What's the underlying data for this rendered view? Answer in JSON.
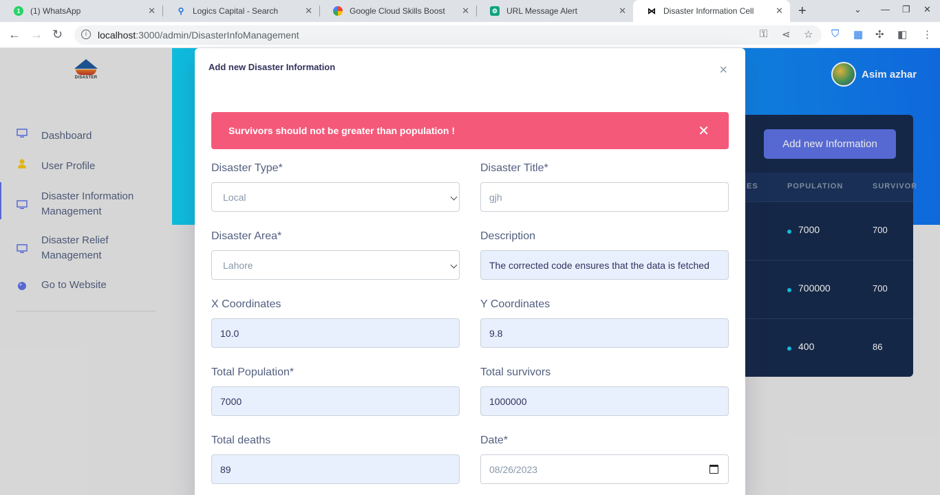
{
  "browser": {
    "tabs": [
      {
        "title": "(1) WhatsApp",
        "icon": "whatsapp-icon",
        "color": "#25d366"
      },
      {
        "title": "Logics Capital - Search",
        "icon": "search-icon",
        "color": "#1a73e8"
      },
      {
        "title": "Google Cloud Skills Boost",
        "icon": "google-cloud-icon",
        "color": "#ea4335"
      },
      {
        "title": "URL Message Alert",
        "icon": "chatgpt-icon",
        "color": "#10a37f"
      },
      {
        "title": "Disaster Information Cell",
        "icon": "app-icon",
        "color": "#000000"
      }
    ],
    "url_host": "localhost",
    "url_path": ":3000/admin/DisasterInfoManagement"
  },
  "sidebar": {
    "logo_text": "DISASTER",
    "items": [
      {
        "label": "Dashboard",
        "icon": "monitor-icon"
      },
      {
        "label": "User Profile",
        "icon": "user-icon"
      },
      {
        "label": "Disaster Information Management",
        "icon": "monitor-icon"
      },
      {
        "label": "Disaster Relief Management",
        "icon": "monitor-icon"
      },
      {
        "label": "Go to Website",
        "icon": "planet-icon"
      }
    ]
  },
  "header": {
    "user_name": "Asim azhar"
  },
  "table": {
    "add_button": "Add new Information",
    "columns": [
      "ES",
      "POPULATION",
      "SURVIVOR"
    ],
    "rows": [
      {
        "population": "7000",
        "survivors": "700"
      },
      {
        "population": "700000",
        "survivors": "700"
      },
      {
        "population": "400",
        "survivors": "86"
      }
    ]
  },
  "modal": {
    "title": "Add new Disaster Information",
    "alert": "Survivors should not be greater than population !",
    "fields": {
      "disaster_type": {
        "label": "Disaster Type*",
        "value": "Local"
      },
      "disaster_title": {
        "label": "Disaster Title*",
        "value": "gjh"
      },
      "disaster_area": {
        "label": "Disaster Area*",
        "value": "Lahore"
      },
      "description": {
        "label": "Description",
        "value": "The corrected code ensures that the data is fetched"
      },
      "x_coord": {
        "label": "X Coordinates",
        "value": "10.0"
      },
      "y_coord": {
        "label": "Y Coordinates",
        "value": "9.8"
      },
      "population": {
        "label": "Total Population*",
        "value": "7000"
      },
      "survivors": {
        "label": "Total survivors",
        "value": "1000000"
      },
      "deaths": {
        "label": "Total deaths",
        "value": "89"
      },
      "date": {
        "label": "Date*",
        "value": "08/26/2023"
      }
    }
  },
  "colors": {
    "accent": "#5e72e4",
    "alert": "#f5597a",
    "header_start": "#11cdef",
    "header_end": "#1171ef",
    "card": "#172b4d"
  }
}
